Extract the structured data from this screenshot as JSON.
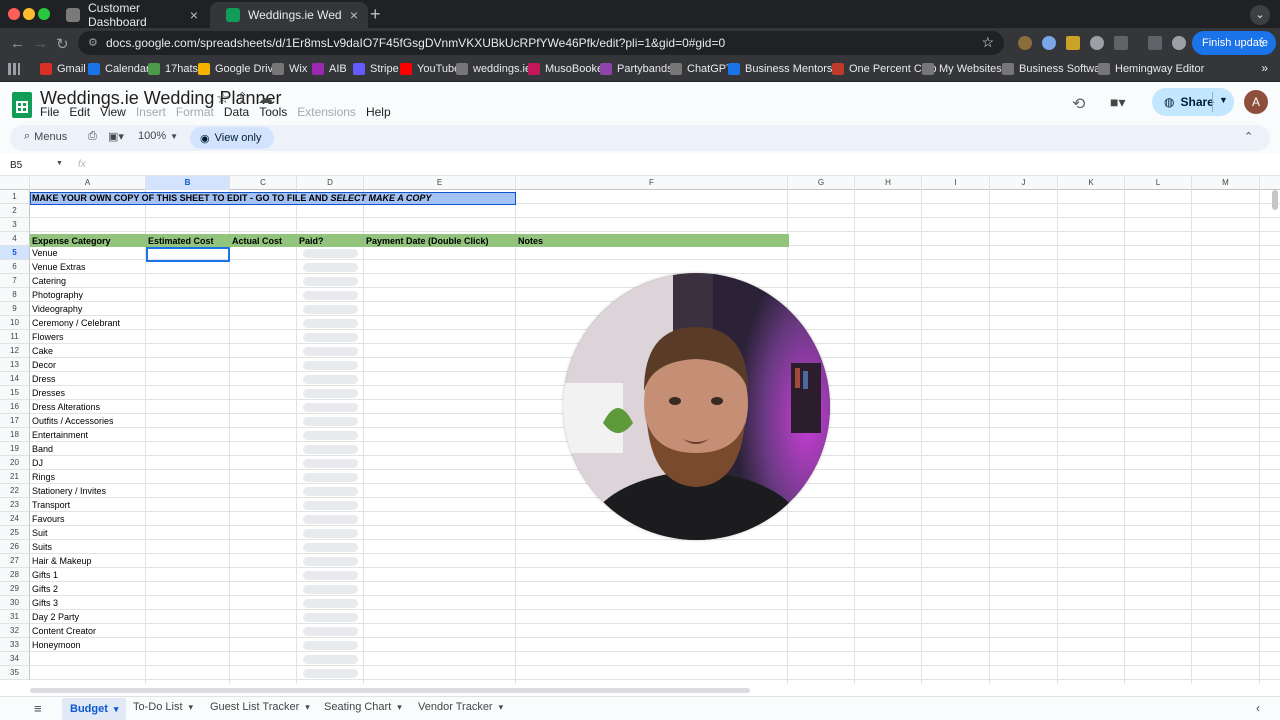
{
  "browser": {
    "tabs": [
      {
        "title": "Customer Dashboard",
        "favicon_color": "#7a7a7a"
      },
      {
        "title": "Weddings.ie Wedding Planne",
        "favicon_color": "#0f9d58"
      }
    ],
    "url": "docs.google.com/spreadsheets/d/1Er8msLv9daIO7F45fGsgDVnmVKXUBkUcRPfYWe46Pfk/edit?pli=1&gid=0#gid=0",
    "finish_update": "Finish update",
    "bookmarks": [
      "Gmail",
      "Calendar",
      "17hats",
      "Google Drive",
      "Wix",
      "AIB",
      "Stripe",
      "YouTube",
      "weddings.ie",
      "MusoBooker",
      "Partybands",
      "ChatGPT",
      "Business Mentors...",
      "One Percent Club",
      "My Websites",
      "Business Software",
      "Hemingway Editor"
    ]
  },
  "sheets": {
    "title": "Weddings.ie Wedding Planner",
    "menus": [
      "File",
      "Edit",
      "View",
      "Insert",
      "Format",
      "Data",
      "Tools",
      "Extensions",
      "Help"
    ],
    "disabled_menus": [
      "Insert",
      "Format",
      "Extensions"
    ],
    "menus_search": "Menus",
    "zoom": "100%",
    "view_only": "View only",
    "share": "Share",
    "avatar_letter": "A",
    "name_box": "B5",
    "fx": "fx",
    "columns": [
      "A",
      "B",
      "C",
      "D",
      "E",
      "F",
      "G",
      "H",
      "I",
      "J",
      "K",
      "L",
      "M"
    ],
    "rows": [
      "1",
      "2",
      "3",
      "4",
      "5",
      "6",
      "7",
      "8",
      "9",
      "10",
      "11",
      "12",
      "13",
      "14",
      "15",
      "16",
      "17",
      "18",
      "19",
      "20",
      "21",
      "22",
      "23",
      "24",
      "25",
      "26",
      "27",
      "28",
      "29",
      "30",
      "31",
      "32",
      "33",
      "34",
      "35"
    ],
    "banner_plain": "MAKE YOUR OWN COPY OF THIS SHEET TO EDIT - GO TO FILE AND ",
    "banner_italic": "SELECT MAKE A COPY",
    "headers": [
      "Expense Category",
      "Estimated Cost",
      "Actual Cost",
      "Paid?",
      "Payment Date (Double Click)",
      "Notes"
    ],
    "categories": [
      "Venue",
      "Venue Extras",
      "Catering",
      "Photography",
      "Videography",
      "Ceremony / Celebrant",
      "Flowers",
      "Cake",
      "Decor",
      "Dress",
      "Dresses",
      "Dress Alterations",
      "Outfits / Accessories",
      "Entertainment",
      "Band",
      "DJ",
      "Rings",
      "Stationery / Invites",
      "Transport",
      "Favours",
      "Suit",
      "Suits",
      "Hair & Makeup",
      "Gifts 1",
      "Gifts 2",
      "Gifts 3",
      "Day 2 Party",
      "Content Creator",
      "Honeymoon"
    ],
    "sheet_tabs": [
      "Budget",
      "To-Do List",
      "Guest List Tracker",
      "Seating Chart",
      "Vendor Tracker"
    ],
    "active_sheet": "Budget"
  },
  "colors": {
    "banner_bg": "#a4c2f4",
    "header_bg": "#93c47d",
    "share_bg": "#c2e7ff",
    "selection": "#1a73e8"
  }
}
